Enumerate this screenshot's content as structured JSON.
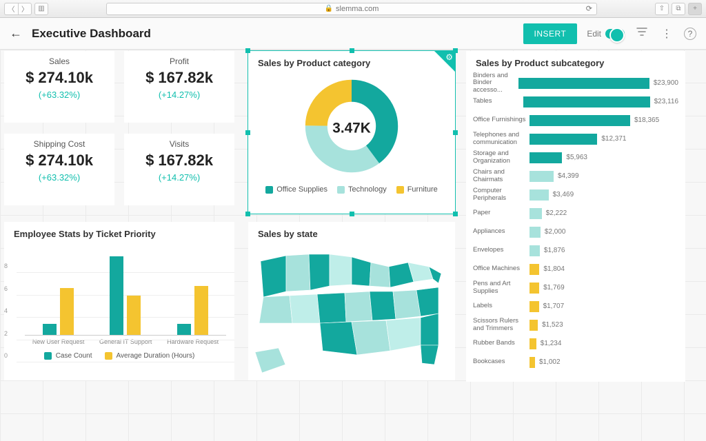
{
  "browser": {
    "url": "slemma.com"
  },
  "toolbar": {
    "title": "Executive Dashboard",
    "insert_label": "INSERT",
    "edit_label": "Edit"
  },
  "colors": {
    "teal": "#13a89e",
    "teal_light": "#a7e2dc",
    "yellow": "#f4c430"
  },
  "kpis": [
    {
      "id": "sales",
      "title": "Sales",
      "value": "$ 274.10k",
      "delta": "(+63.32%)"
    },
    {
      "id": "profit",
      "title": "Profit",
      "value": "$ 167.82k",
      "delta": "(+14.27%)"
    },
    {
      "id": "shipping",
      "title": "Shipping Cost",
      "value": "$ 274.10k",
      "delta": "(+63.32%)"
    },
    {
      "id": "visits",
      "title": "Visits",
      "value": "$ 167.82k",
      "delta": "(+14.27%)"
    }
  ],
  "donut": {
    "title": "Sales by Product category",
    "center_label": "3.47K",
    "legend": [
      "Office Supplies",
      "Technology",
      "Furniture"
    ]
  },
  "subcategory": {
    "title": "Sales by Product subcategory",
    "rows": [
      {
        "label": "Binders and Binder accesso...",
        "value_label": "$23,900",
        "value": 23900,
        "color": "teal"
      },
      {
        "label": "Tables",
        "value_label": "$23,116",
        "value": 23116,
        "color": "teal"
      },
      {
        "label": "Office Furnishings",
        "value_label": "$18,365",
        "value": 18365,
        "color": "teal"
      },
      {
        "label": "Telephones and communication",
        "value_label": "$12,371",
        "value": 12371,
        "color": "teal"
      },
      {
        "label": "Storage and Organization",
        "value_label": "$5,963",
        "value": 5963,
        "color": "teal"
      },
      {
        "label": "Chairs and Chairmats",
        "value_label": "$4,399",
        "value": 4399,
        "color": "teal_light"
      },
      {
        "label": "Computer Peripherals",
        "value_label": "$3,469",
        "value": 3469,
        "color": "teal_light"
      },
      {
        "label": "Paper",
        "value_label": "$2,222",
        "value": 2222,
        "color": "teal_light"
      },
      {
        "label": "Appliances",
        "value_label": "$2,000",
        "value": 2000,
        "color": "teal_light"
      },
      {
        "label": "Envelopes",
        "value_label": "$1,876",
        "value": 1876,
        "color": "teal_light"
      },
      {
        "label": "Office Machines",
        "value_label": "$1,804",
        "value": 1804,
        "color": "yellow"
      },
      {
        "label": "Pens and Art Supplies",
        "value_label": "$1,769",
        "value": 1769,
        "color": "yellow"
      },
      {
        "label": "Labels",
        "value_label": "$1,707",
        "value": 1707,
        "color": "yellow"
      },
      {
        "label": "Scissors Rulers and Trimmers",
        "value_label": "$1,523",
        "value": 1523,
        "color": "yellow"
      },
      {
        "label": "Rubber Bands",
        "value_label": "$1,234",
        "value": 1234,
        "color": "yellow"
      },
      {
        "label": "Bookcases",
        "value_label": "$1,002",
        "value": 1002,
        "color": "yellow"
      }
    ]
  },
  "employee": {
    "title": "Employee Stats by Ticket Priority",
    "y_ticks": [
      0,
      2,
      4,
      6,
      8
    ],
    "categories": [
      "New User Request",
      "General IT Support",
      "Hardware Request"
    ],
    "series": [
      {
        "name": "Case Count",
        "color": "teal",
        "values": [
          1.0,
          7.0,
          1.0
        ]
      },
      {
        "name": "Average Duration (Hours)",
        "color": "yellow",
        "values": [
          4.2,
          3.5,
          4.4
        ]
      }
    ]
  },
  "map": {
    "title": "Sales by state"
  },
  "chart_data": [
    {
      "type": "pie",
      "title": "Sales by Product category",
      "center_label": "3.47K",
      "series": [
        {
          "name": "Office Supplies",
          "value": 40
        },
        {
          "name": "Technology",
          "value": 35
        },
        {
          "name": "Furniture",
          "value": 25
        }
      ]
    },
    {
      "type": "bar",
      "title": "Sales by Product subcategory",
      "orientation": "horizontal",
      "categories": [
        "Binders and Binder accessories",
        "Tables",
        "Office Furnishings",
        "Telephones and communication",
        "Storage and Organization",
        "Chairs and Chairmats",
        "Computer Peripherals",
        "Paper",
        "Appliances",
        "Envelopes",
        "Office Machines",
        "Pens and Art Supplies",
        "Labels",
        "Scissors Rulers and Trimmers",
        "Rubber Bands",
        "Bookcases"
      ],
      "values": [
        23900,
        23116,
        18365,
        12371,
        5963,
        4399,
        3469,
        2222,
        2000,
        1876,
        1804,
        1769,
        1707,
        1523,
        1234,
        1002
      ]
    },
    {
      "type": "bar",
      "title": "Employee Stats by Ticket Priority",
      "categories": [
        "New User Request",
        "General IT Support",
        "Hardware Request"
      ],
      "ylim": [
        0,
        8
      ],
      "series": [
        {
          "name": "Case Count",
          "values": [
            1.0,
            7.0,
            1.0
          ]
        },
        {
          "name": "Average Duration (Hours)",
          "values": [
            4.2,
            3.5,
            4.4
          ]
        }
      ]
    },
    {
      "type": "heatmap",
      "title": "Sales by state",
      "note": "US choropleth map; per-state values not labeled in source"
    }
  ]
}
